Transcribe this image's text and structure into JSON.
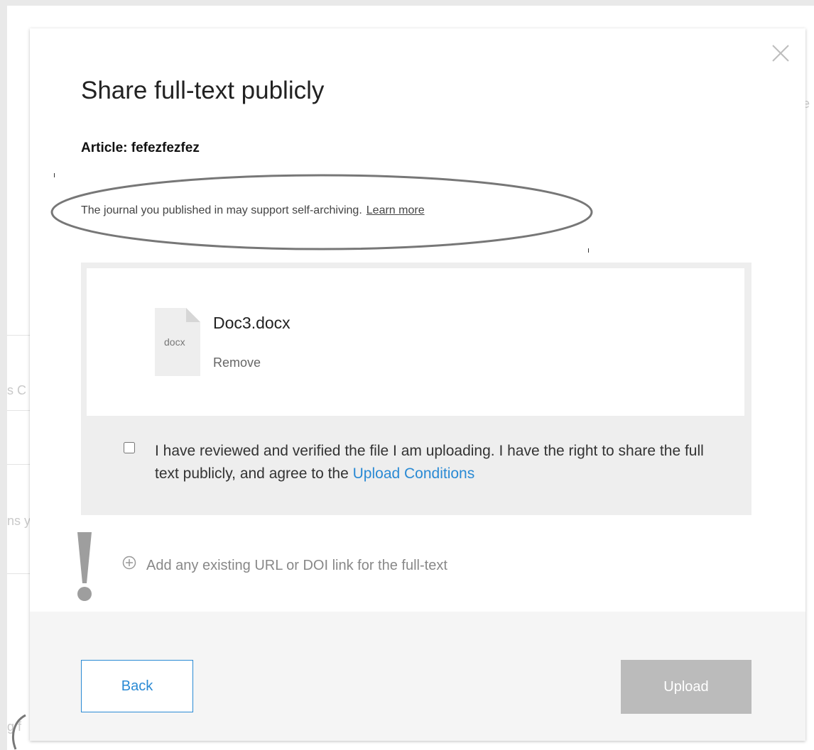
{
  "modal": {
    "title": "Share full-text publicly",
    "article_label": "Article: fefezfezfez",
    "journal_note": "The journal you published in may support self-archiving.",
    "learn_more": "Learn more"
  },
  "file": {
    "icon_label": "docx",
    "name": "Doc3.docx",
    "remove_label": "Remove"
  },
  "consent": {
    "checked": false,
    "text": "I have reviewed and verified the file I am uploading. I have the right to share the full text publicly, and agree to the ",
    "link_label": "Upload Conditions"
  },
  "add_link": {
    "label": "Add any existing URL or DOI link for the full-text"
  },
  "footer": {
    "back_label": "Back",
    "upload_label": "Upload",
    "upload_disabled": true
  },
  "colors": {
    "accent": "#2a8ad4",
    "disabled_button": "#bbbbbb",
    "panel_bg": "#eeeeee",
    "footer_bg": "#f5f5f5"
  },
  "icons": {
    "close": "close-icon",
    "file": "file-docx-icon",
    "add": "add-circle-icon",
    "annotation": "exclamation-icon"
  }
}
